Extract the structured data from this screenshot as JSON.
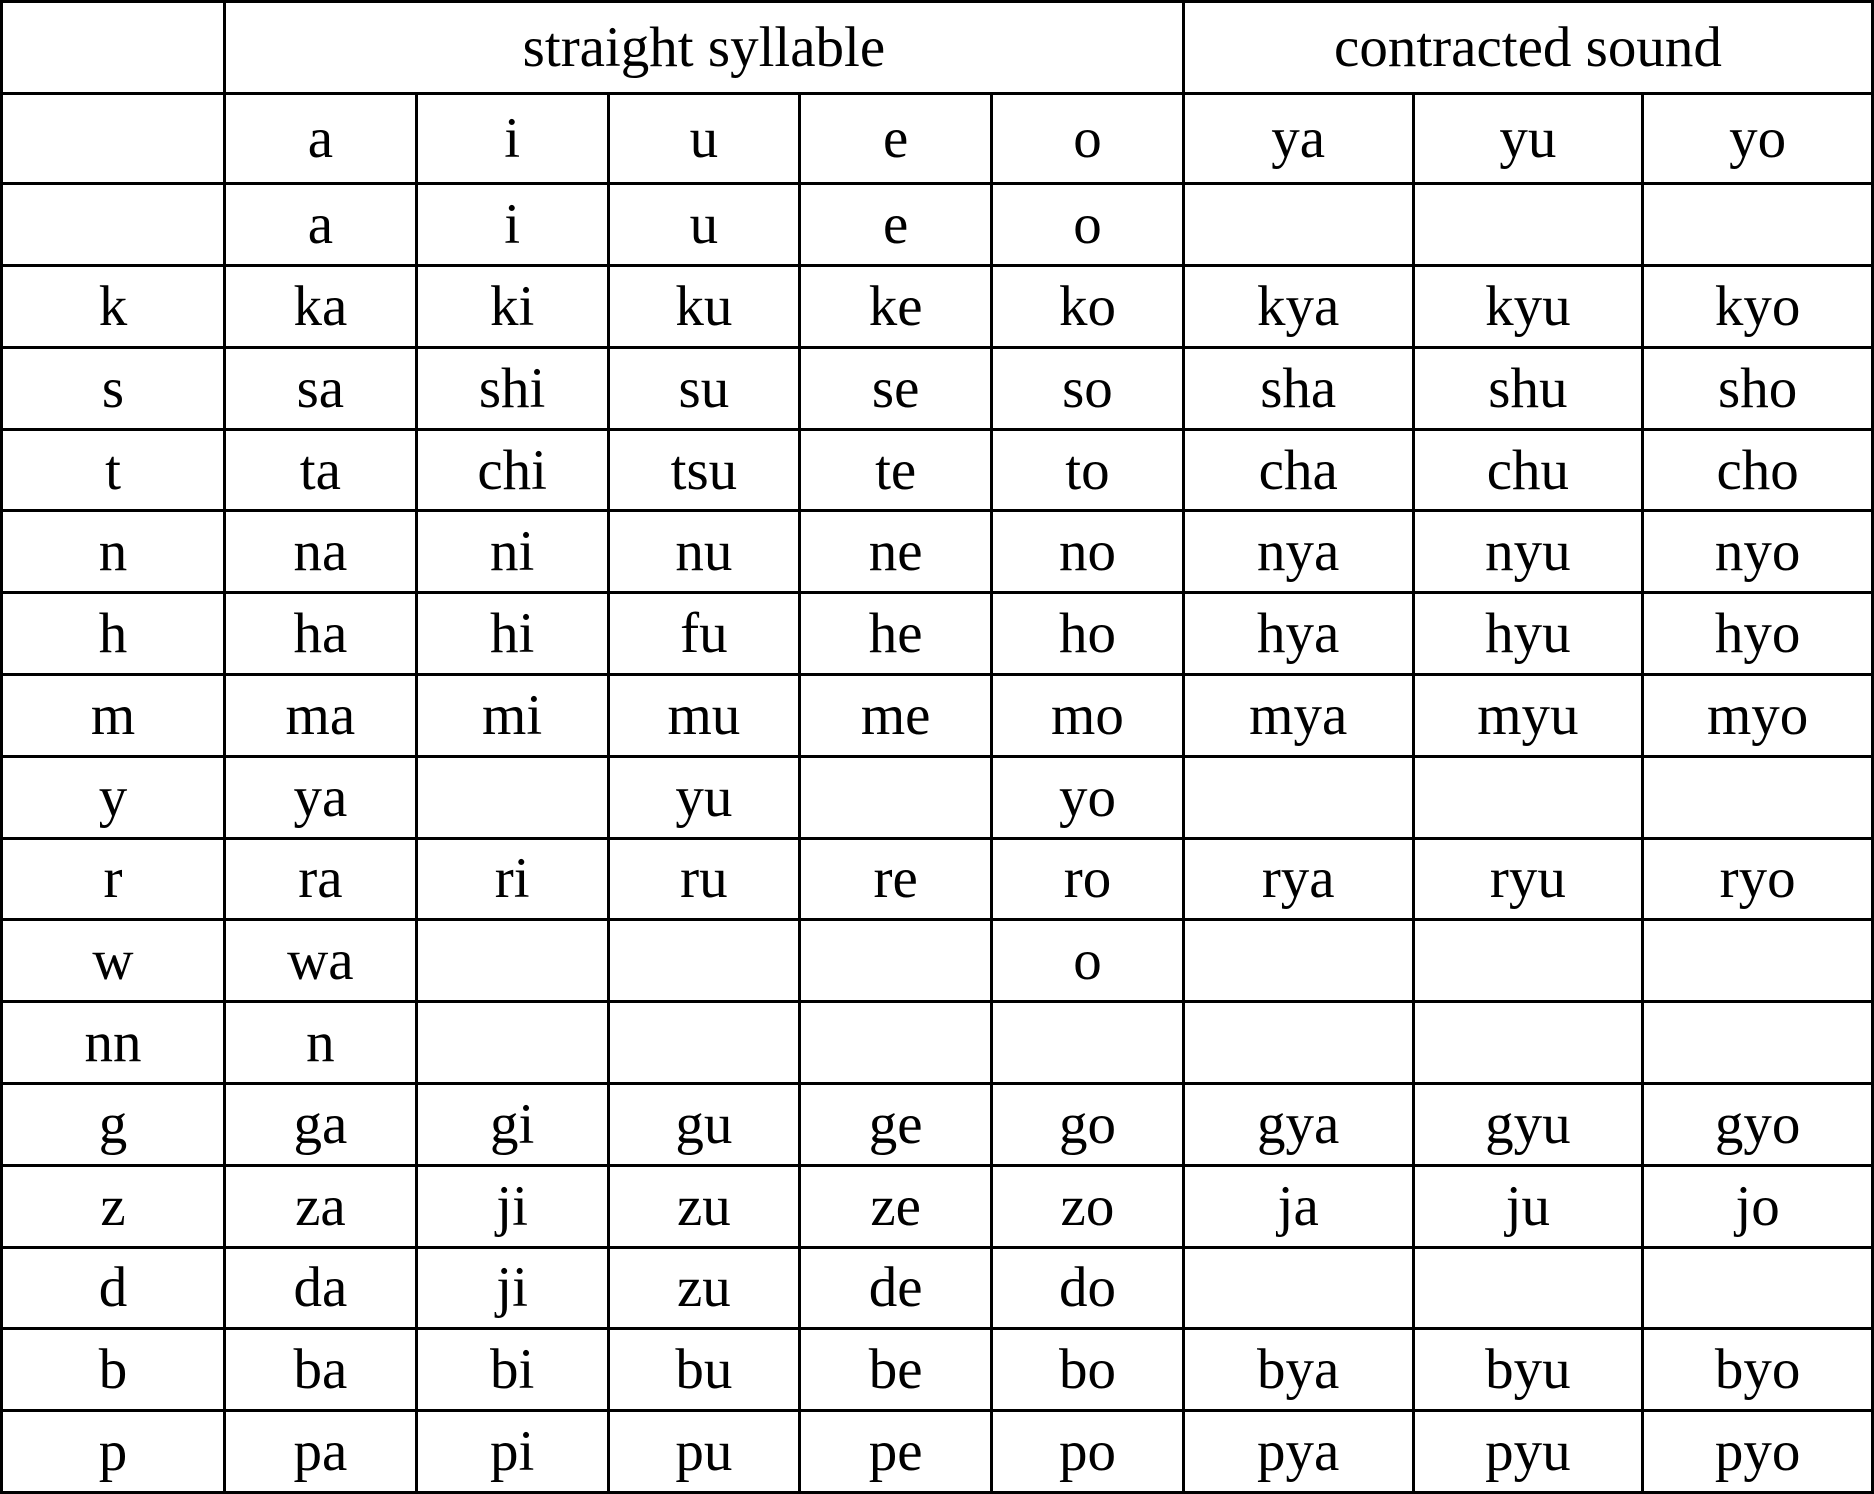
{
  "table": {
    "banner": {
      "corner": "",
      "straight_syllable": "straight syllable",
      "contracted_sound": "contracted sound"
    },
    "column_headers": {
      "corner": "",
      "vowels": [
        "a",
        "i",
        "u",
        "e",
        "o"
      ],
      "yoon": [
        "ya",
        "yu",
        "yo"
      ]
    },
    "colors": {
      "light_green": "#7EF24E",
      "dark_green": "#5AD433",
      "cell_background": "#ffffff",
      "border": "#000000",
      "text": "#000000"
    },
    "rows": [
      {
        "label": "",
        "vowels": [
          "a",
          "i",
          "u",
          "e",
          "o"
        ],
        "yoon": [
          "",
          "",
          ""
        ]
      },
      {
        "label": "k",
        "vowels": [
          "ka",
          "ki",
          "ku",
          "ke",
          "ko"
        ],
        "yoon": [
          "kya",
          "kyu",
          "kyo"
        ]
      },
      {
        "label": "s",
        "vowels": [
          "sa",
          "shi",
          "su",
          "se",
          "so"
        ],
        "yoon": [
          "sha",
          "shu",
          "sho"
        ]
      },
      {
        "label": "t",
        "vowels": [
          "ta",
          "chi",
          "tsu",
          "te",
          "to"
        ],
        "yoon": [
          "cha",
          "chu",
          "cho"
        ]
      },
      {
        "label": "n",
        "vowels": [
          "na",
          "ni",
          "nu",
          "ne",
          "no"
        ],
        "yoon": [
          "nya",
          "nyu",
          "nyo"
        ]
      },
      {
        "label": "h",
        "vowels": [
          "ha",
          "hi",
          "fu",
          "he",
          "ho"
        ],
        "yoon": [
          "hya",
          "hyu",
          "hyo"
        ]
      },
      {
        "label": "m",
        "vowels": [
          "ma",
          "mi",
          "mu",
          "me",
          "mo"
        ],
        "yoon": [
          "mya",
          "myu",
          "myo"
        ]
      },
      {
        "label": "y",
        "vowels": [
          "ya",
          "",
          "yu",
          "",
          "yo"
        ],
        "yoon": [
          "",
          "",
          ""
        ]
      },
      {
        "label": "r",
        "vowels": [
          "ra",
          "ri",
          "ru",
          "re",
          "ro"
        ],
        "yoon": [
          "rya",
          "ryu",
          "ryo"
        ]
      },
      {
        "label": "w",
        "vowels": [
          "wa",
          "",
          "",
          "",
          "o"
        ],
        "yoon": [
          "",
          "",
          ""
        ]
      },
      {
        "label": "nn",
        "vowels": [
          "n",
          "",
          "",
          "",
          ""
        ],
        "yoon": [
          "",
          "",
          ""
        ]
      },
      {
        "label": "g",
        "vowels": [
          "ga",
          "gi",
          "gu",
          "ge",
          "go"
        ],
        "yoon": [
          "gya",
          "gyu",
          "gyo"
        ]
      },
      {
        "label": "z",
        "vowels": [
          "za",
          "ji",
          "zu",
          "ze",
          "zo"
        ],
        "yoon": [
          "ja",
          "ju",
          "jo"
        ]
      },
      {
        "label": "d",
        "vowels": [
          "da",
          "ji",
          "zu",
          "de",
          "do"
        ],
        "yoon": [
          "",
          "",
          ""
        ]
      },
      {
        "label": "b",
        "vowels": [
          "ba",
          "bi",
          "bu",
          "be",
          "bo"
        ],
        "yoon": [
          "bya",
          "byu",
          "byo"
        ]
      },
      {
        "label": "p",
        "vowels": [
          "pa",
          "pi",
          "pu",
          "pe",
          "po"
        ],
        "yoon": [
          "pya",
          "pyu",
          "pyo"
        ]
      }
    ]
  }
}
